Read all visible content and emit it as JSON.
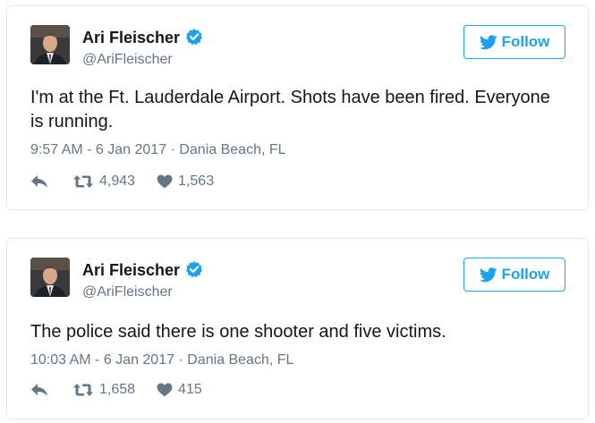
{
  "colors": {
    "brand": "#1da1f2",
    "muted": "#657786",
    "text": "#14171a",
    "border": "#e1e8ed"
  },
  "tweets": [
    {
      "author_name": "Ari Fleischer",
      "handle": "@AriFleischer",
      "verified": true,
      "follow_label": "Follow",
      "text": "I'm at the Ft. Lauderdale Airport. Shots have been fired. Everyone is running.",
      "timestamp": "9:57 AM - 6 Jan 2017",
      "separator": "·",
      "location": "Dania Beach, FL",
      "retweets": "4,943",
      "likes": "1,563",
      "icons": [
        "reply-icon",
        "retweet-icon",
        "heart-icon",
        "twitter-bird-icon",
        "verified-badge-icon"
      ]
    },
    {
      "author_name": "Ari Fleischer",
      "handle": "@AriFleischer",
      "verified": true,
      "follow_label": "Follow",
      "text": "The police said there is one shooter and five victims.",
      "timestamp": "10:03 AM - 6 Jan 2017",
      "separator": "·",
      "location": "Dania Beach, FL",
      "retweets": "1,658",
      "likes": "415",
      "icons": [
        "reply-icon",
        "retweet-icon",
        "heart-icon",
        "twitter-bird-icon",
        "verified-badge-icon"
      ]
    }
  ]
}
